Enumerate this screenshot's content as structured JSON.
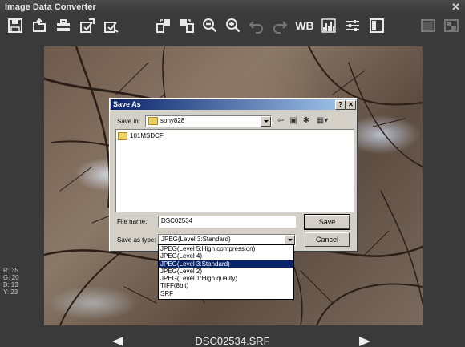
{
  "app": {
    "title": "Image Data Converter",
    "close": "✕"
  },
  "toolbar": {
    "wb_label": "WB",
    "icons": [
      "save-icon",
      "open-icon",
      "batch-icon",
      "convert-icon",
      "export-icon",
      "compare-icon",
      "compare2-icon",
      "zoom-out-icon",
      "zoom-in-icon",
      "undo-icon",
      "redo-icon",
      "white-balance",
      "histogram-icon",
      "adjust-icon",
      "panel-icon",
      "view1-icon",
      "view2-icon"
    ]
  },
  "readout": {
    "r": "R: 35",
    "g": "G: 20",
    "b": "B: 13",
    "y": "Y: 23"
  },
  "bottom": {
    "filename": "DSC02534.SRF"
  },
  "dialog": {
    "title": "Save As",
    "help_btn": "?",
    "close_btn": "✕",
    "save_in_label": "Save in:",
    "save_in_value": "sony828",
    "files": [
      "101MSDCF"
    ],
    "file_name_label": "File name:",
    "file_name_value": "DSC02534",
    "save_as_type_label": "Save as type:",
    "save_as_type_value": "JPEG(Level 3:Standard)",
    "save_button": "Save",
    "cancel_button": "Cancel",
    "type_options": [
      "JPEG(Level 5:High compression)",
      "JPEG(Level 4)",
      "JPEG(Level 3:Standard)",
      "JPEG(Level 2)",
      "JPEG(Level 1:High quality)",
      "TIFF(8bit)",
      "SRF"
    ],
    "selected_option_index": 2
  }
}
